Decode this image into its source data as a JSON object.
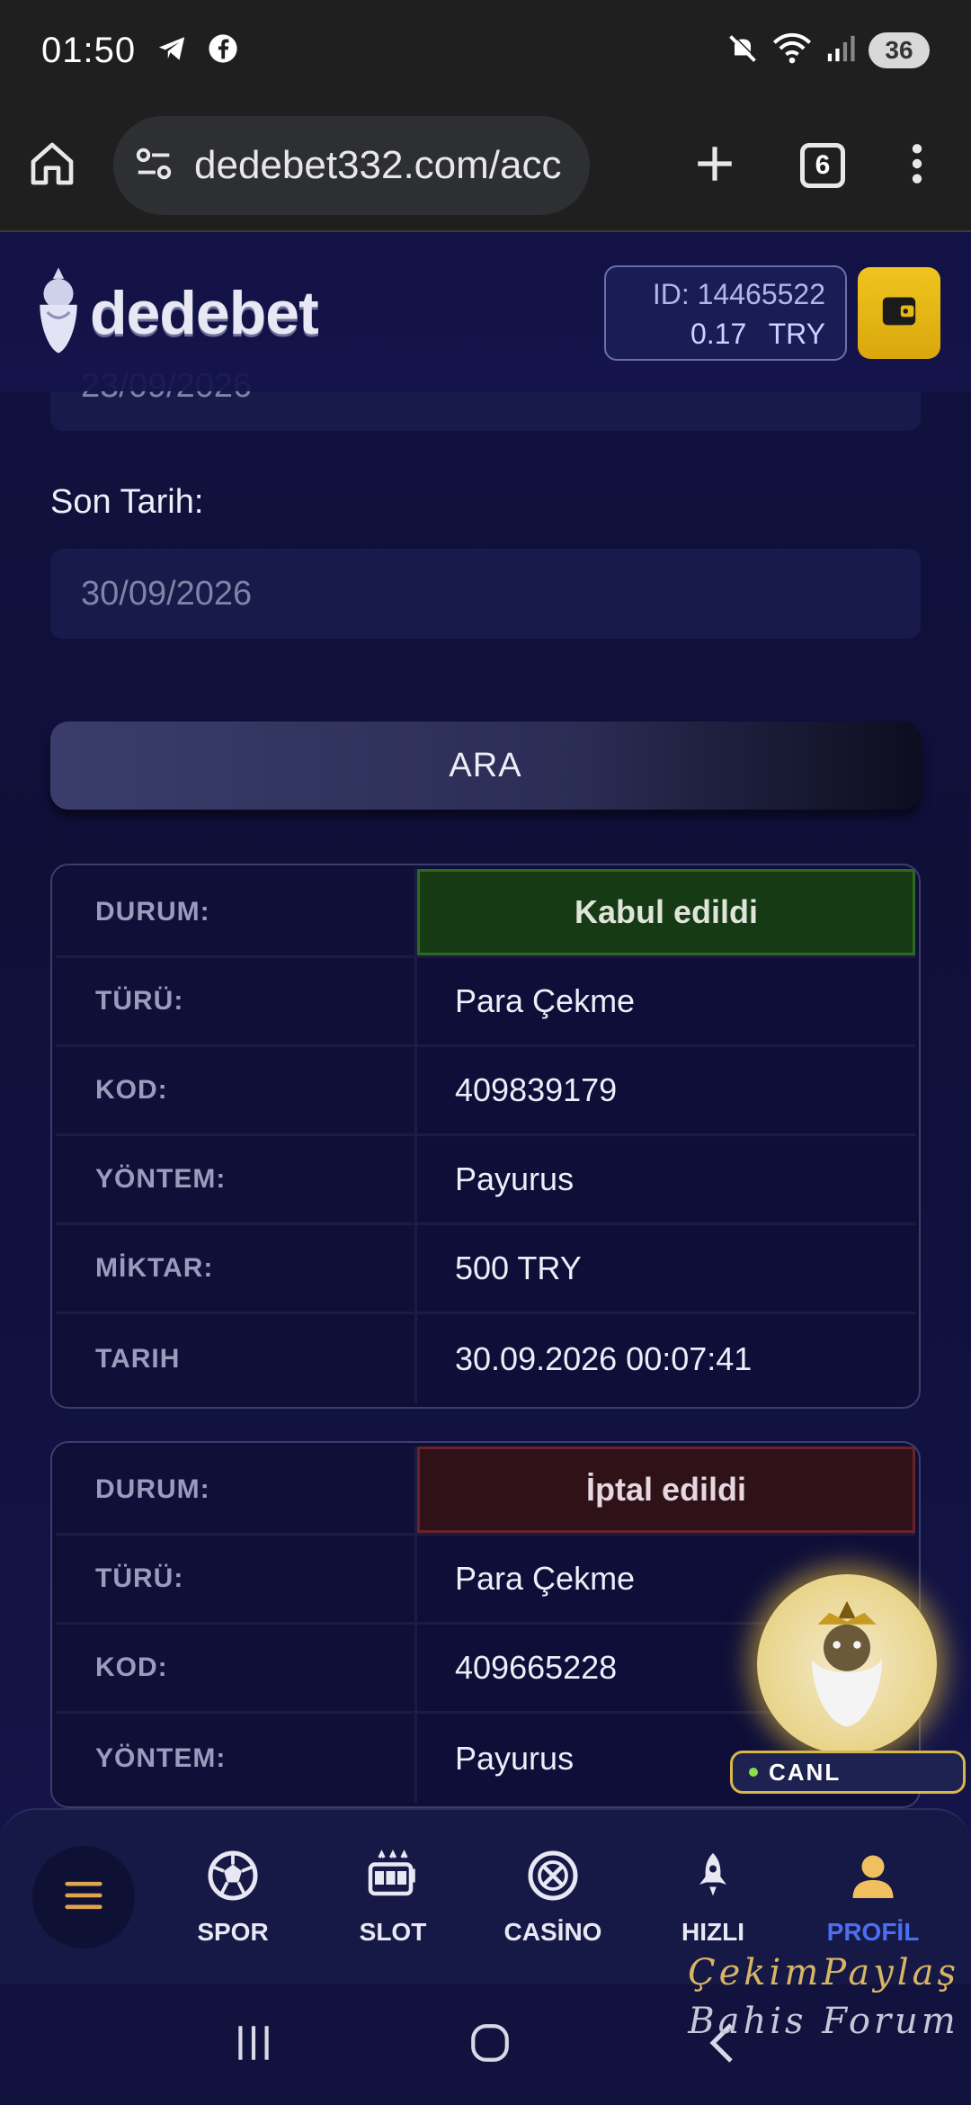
{
  "status_bar": {
    "time": "01:50",
    "battery": "36"
  },
  "browser": {
    "url": "dedebet332.com/acc",
    "tab_count": "6"
  },
  "header": {
    "logo_text": "dedebet",
    "balance_id": "ID: 14465522",
    "balance_amount": "0.17 TRY"
  },
  "filters": {
    "start_date_value": "23/09/2026",
    "end_date_label": "Son Tarih:",
    "end_date_value": "30/09/2026",
    "search_label": "ARA"
  },
  "transactions": [
    {
      "rows": [
        {
          "key": "DURUM:",
          "value": "Kabul edildi"
        },
        {
          "key": "TÜRÜ:",
          "value": "Para Çekme"
        },
        {
          "key": "KOD:",
          "value": "409839179"
        },
        {
          "key": "YÖNTEM:",
          "value": "Payurus"
        },
        {
          "key": "MİKTAR:",
          "value": "500 TRY"
        },
        {
          "key": "TARIH",
          "value": "30.09.2026 00:07:41"
        }
      ]
    },
    {
      "rows": [
        {
          "key": "DURUM:",
          "value": "İptal edildi"
        },
        {
          "key": "TÜRÜ:",
          "value": "Para Çekme"
        },
        {
          "key": "KOD:",
          "value": "409665228"
        },
        {
          "key": "YÖNTEM:",
          "value": "Payurus"
        }
      ]
    }
  ],
  "live_badge": {
    "label": "CANL"
  },
  "bottom_nav": {
    "items": [
      {
        "label": "SPOR",
        "icon": "soccer-ball-icon"
      },
      {
        "label": "SLOT",
        "icon": "slot-machine-icon"
      },
      {
        "label": "CASİNO",
        "icon": "roulette-icon"
      },
      {
        "label": "HIZLI",
        "icon": "rocket-icon"
      },
      {
        "label": "PROFİL",
        "icon": "user-icon"
      }
    ]
  },
  "watermark": {
    "line1": "ÇekimPaylaş",
    "line2": "Bahis Forum"
  },
  "colors": {
    "accent_active": "#4b6ff0",
    "wallet": "#f0c51e",
    "accepted": "#163a14",
    "cancelled": "#2e1218"
  }
}
